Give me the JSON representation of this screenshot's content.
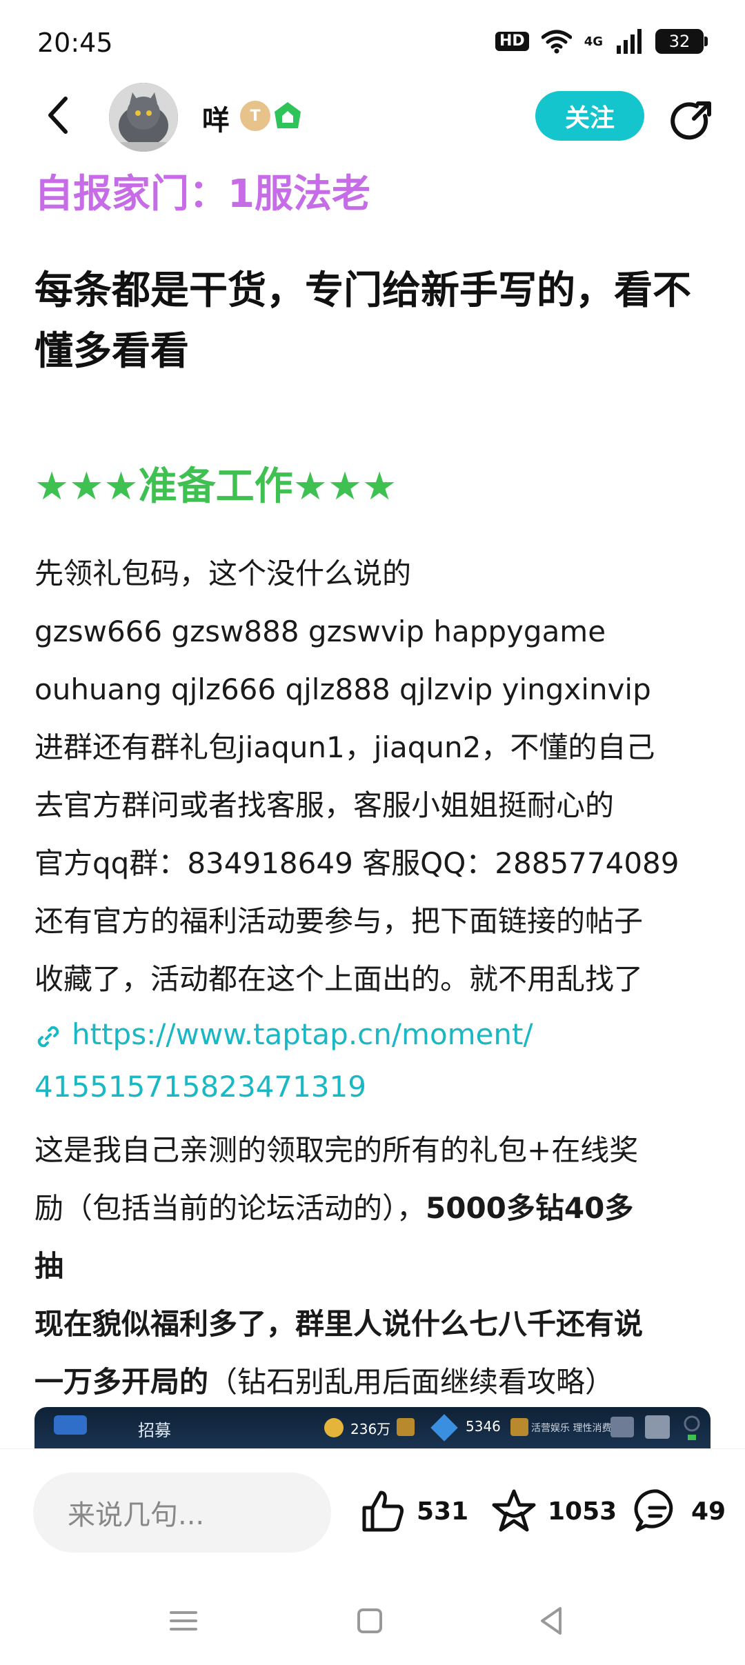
{
  "status_bar": {
    "time": "20:45",
    "hd_label": "HD",
    "network_label": "4G",
    "battery": "32"
  },
  "header": {
    "username": "咩",
    "level_badge": "T",
    "follow_label": "关注"
  },
  "post": {
    "intro": "自报家门：1服法老",
    "title": "每条都是干货，专门给新手写的，看不懂多看看",
    "section_heading": "★★★准备工作★★★",
    "body_lines": [
      "先领礼包码，这个没什么说的",
      "gzsw666 gzsw888 gzswvip happygame",
      "ouhuang qjlz666 qjlz888 qjlzvip  yingxinvip",
      "进群还有群礼包jiaqun1，jiaqun2，不懂的自己",
      "去官方群问或者找客服，客服小姐姐挺耐心的",
      "官方qq群：834918649  客服QQ：2885774089",
      "还有官方的福利活动要参与，把下面链接的帖子",
      "收藏了，活动都在这个上面出的。就不用乱找了"
    ],
    "link_line1": "https://www.taptap.cn/moment/",
    "link_line2": "415515715823471319",
    "body2_line1": "这是我自己亲测的领取完的所有的礼包+在线奖",
    "body2_line2_normal": "励（包括当前的论坛活动的），",
    "body2_line2_bold": "5000多钻40多",
    "body2_line3_bold": "抽",
    "body2_line4_bold": "现在貌似福利多了，群里人说什么七八千还有说",
    "body2_line5_bold": "一万多开局的",
    "body2_line5_normal": "（钻石别乱用后面继续看攻略）"
  },
  "game_image": {
    "tab_title": "招募",
    "gold": "236万",
    "diamonds": "5346",
    "small_text": "活营娱乐 理性消费"
  },
  "bottom_bar": {
    "comment_placeholder": "来说几句...",
    "likes": "531",
    "favorites": "1053",
    "comments": "49"
  },
  "colors": {
    "accent": "#15c5ce",
    "intro": "#c66ce6",
    "heading": "#3fc152",
    "link": "#1ab8c4"
  }
}
